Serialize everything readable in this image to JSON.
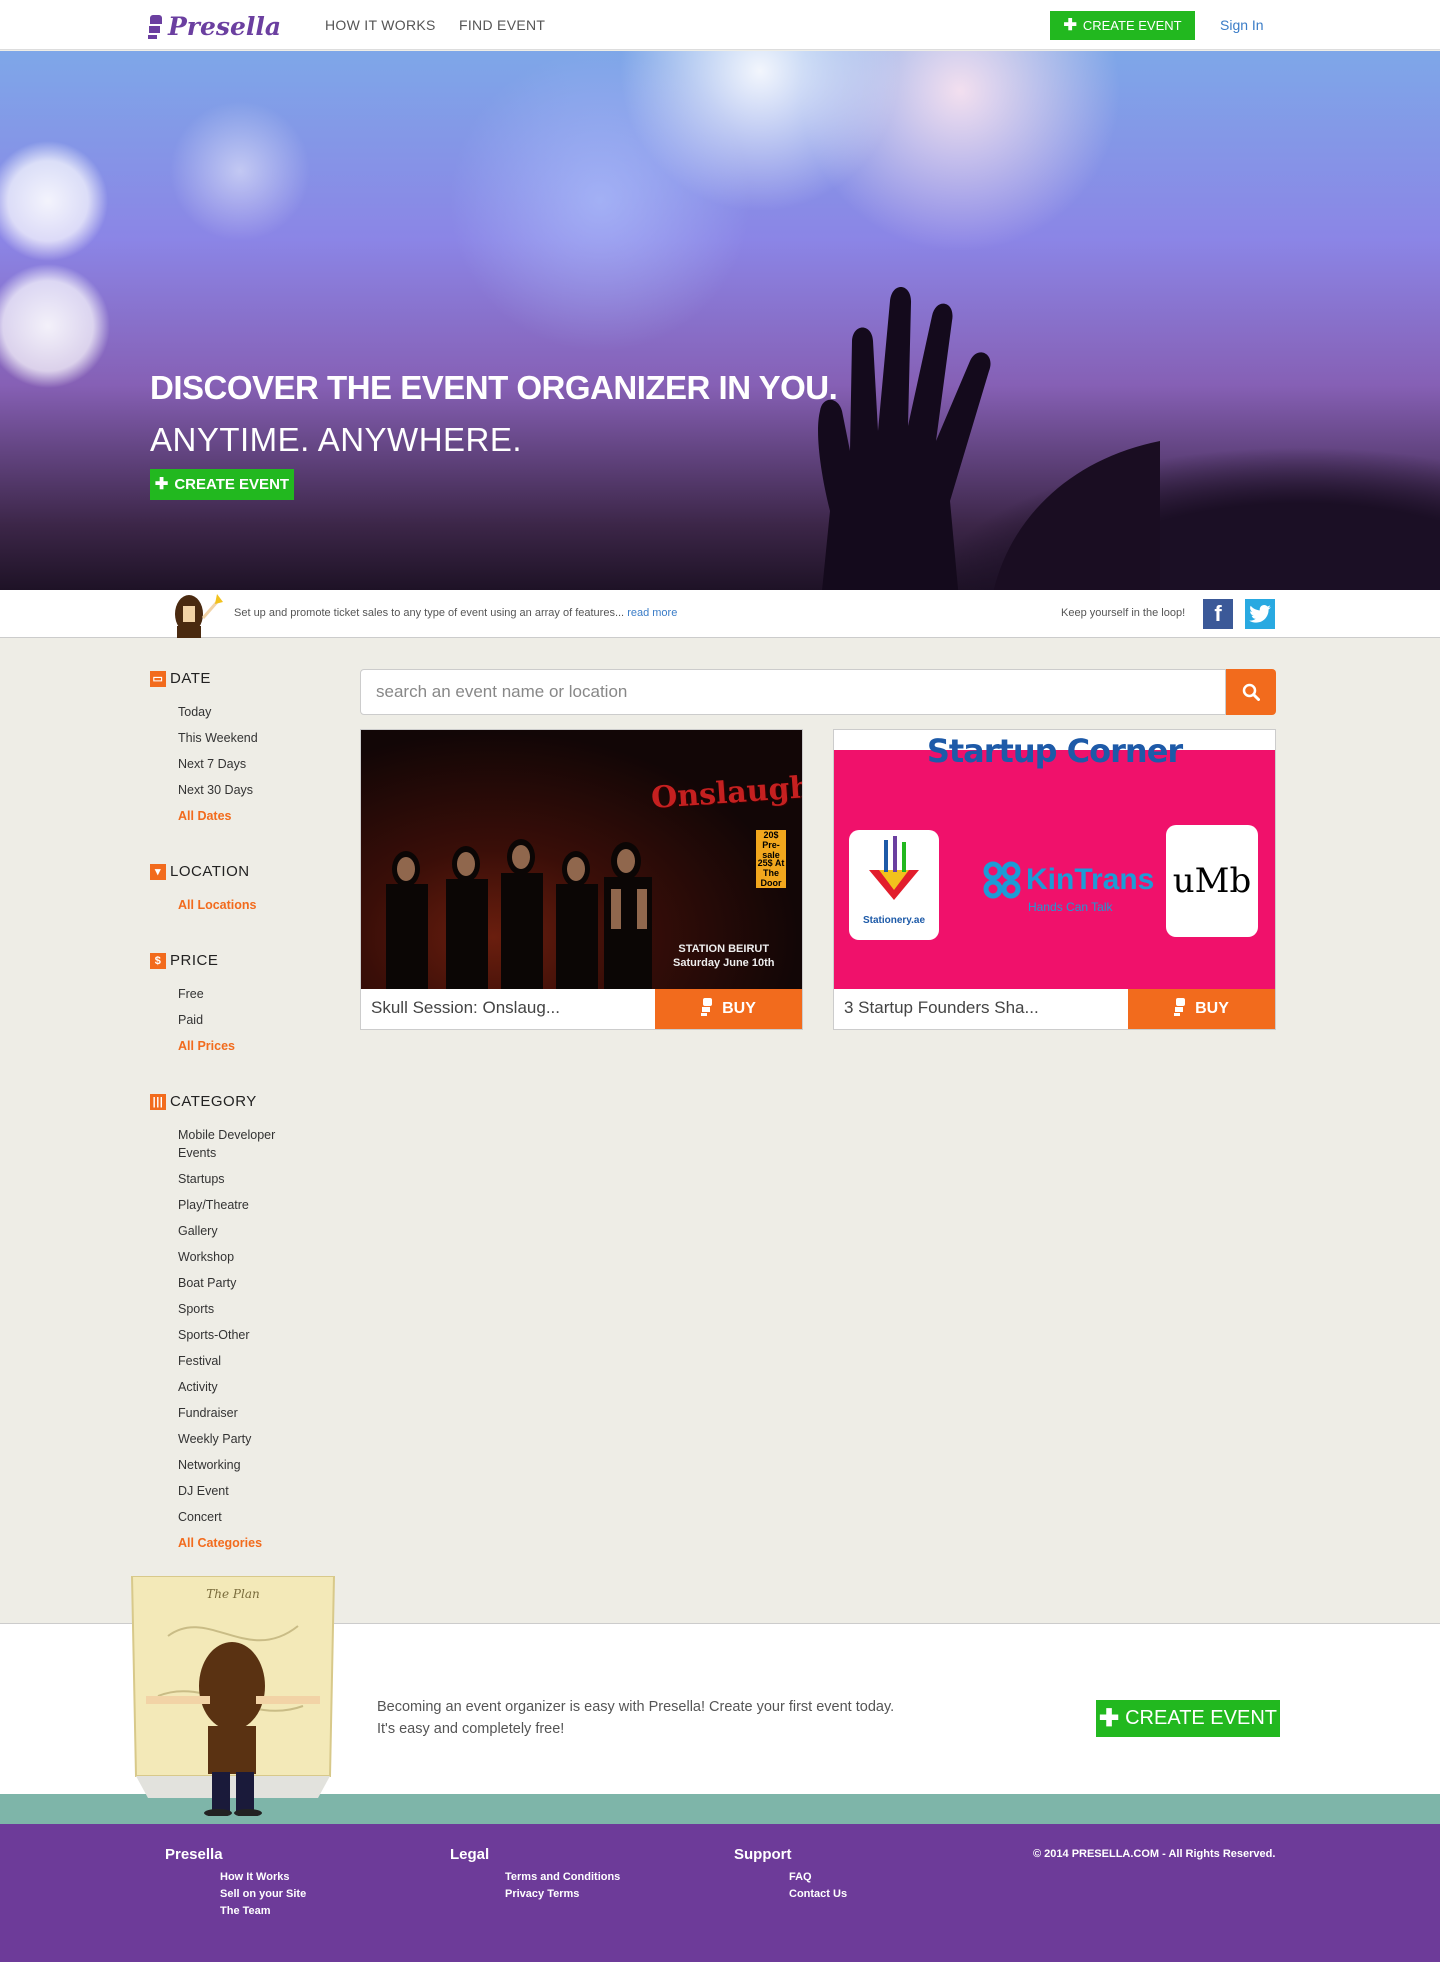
{
  "header": {
    "brand": "Presella",
    "nav": [
      "HOW IT WORKS",
      "FIND EVENT"
    ],
    "create_event": "CREATE EVENT",
    "sign_in": "Sign In"
  },
  "hero": {
    "title": "DISCOVER THE EVENT ORGANIZER IN YOU.",
    "subtitle": "ANYTIME. ANYWHERE.",
    "cta": "CREATE EVENT"
  },
  "strip": {
    "text": "Set up and promote ticket sales to any type of event using an array of features...",
    "read_more": "read more",
    "loop": "Keep yourself in the loop!"
  },
  "filters": {
    "date": {
      "title": "DATE",
      "items": [
        "Today",
        "This Weekend",
        "Next 7 Days",
        "Next 30 Days"
      ],
      "all": "All Dates"
    },
    "location": {
      "title": "LOCATION",
      "all": "All Locations"
    },
    "price": {
      "title": "PRICE",
      "items": [
        "Free",
        "Paid"
      ],
      "all": "All Prices"
    },
    "category": {
      "title": "CATEGORY",
      "items": [
        "Mobile Developer Events",
        "Startups",
        "Play/Theatre",
        "Gallery",
        "Workshop",
        "Boat Party",
        "Sports",
        "Sports-Other",
        "Festival",
        "Activity",
        "Fundraiser",
        "Weekly Party",
        "Networking",
        "DJ Event",
        "Concert"
      ],
      "all": "All Categories"
    }
  },
  "search": {
    "placeholder": "search an event name or location"
  },
  "events": [
    {
      "title": "Skull Session: Onslaug...",
      "buy": "BUY",
      "poster": {
        "band": "Onslaught",
        "venue": "STATION BEIRUT",
        "date": "Saturday June 10th",
        "presale": "20$ Pre-sale",
        "door": "25$ At The Door"
      }
    },
    {
      "title": "3 Startup Founders Sha...",
      "buy": "BUY",
      "poster": {
        "heading": "Startup Corner",
        "logo1": "Stationery.ae",
        "logo2": "KinTrans",
        "logo2_tag": "Hands Can Talk",
        "logo3": "uMb"
      }
    }
  ],
  "cta": {
    "line1": "Becoming an event organizer is easy with Presella! Create your first event today.",
    "line2": "It's easy and completely free!",
    "button": "CREATE EVENT",
    "mascot_label": "The Plan"
  },
  "footer": {
    "cols": [
      {
        "title": "Presella",
        "links": [
          "How It Works",
          "Sell on your Site",
          "The Team"
        ]
      },
      {
        "title": "Legal",
        "links": [
          "Terms and Conditions",
          "Privacy Terms"
        ]
      },
      {
        "title": "Support",
        "links": [
          "FAQ",
          "Contact Us"
        ]
      }
    ],
    "copyright": "© 2014 PRESELLA.COM - All Rights Reserved."
  },
  "colors": {
    "brand": "#6b3fa0",
    "green": "#22b81f",
    "orange": "#f26b1d",
    "footer": "#6d3b99",
    "teal": "#7eb5a9"
  },
  "icons": [
    "logo-mark-icon",
    "plus-icon",
    "facebook-icon",
    "twitter-icon",
    "calendar-icon",
    "location-icon",
    "dollar-icon",
    "category-icon",
    "search-icon",
    "ticket-icon"
  ]
}
